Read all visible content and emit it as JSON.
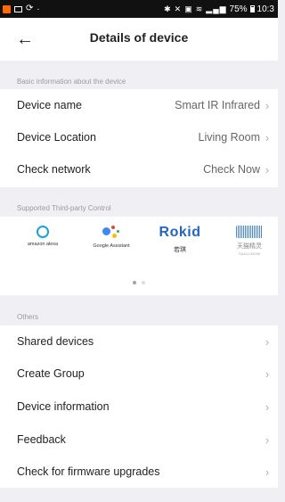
{
  "status_bar": {
    "battery_text": "75%",
    "time": "10:3"
  },
  "header": {
    "title": "Details of device"
  },
  "basic_info": {
    "section_label": "Basic information about the device",
    "rows": [
      {
        "label": "Device name",
        "value": "Smart IR Infrared"
      },
      {
        "label": "Device Location",
        "value": "Living Room"
      },
      {
        "label": "Check network",
        "value": "Check Now"
      }
    ]
  },
  "third_party": {
    "section_label": "Supported Third-party Control",
    "brands": [
      {
        "name": "amazon alexa"
      },
      {
        "name": "Google Assistant"
      },
      {
        "name": "Rokid",
        "caption": "若琪"
      },
      {
        "name": "天猫精灵",
        "caption": "TMALLGENIE"
      }
    ],
    "pager": {
      "page": 1,
      "total": 2
    }
  },
  "others": {
    "section_label": "Others",
    "items": [
      {
        "label": "Shared devices"
      },
      {
        "label": "Create Group"
      },
      {
        "label": "Device information"
      },
      {
        "label": "Feedback"
      },
      {
        "label": "Check for firmware upgrades"
      }
    ]
  },
  "colors": {
    "alexa_blue": "#1aa0e0",
    "rokid_blue": "#2466c0",
    "tmall_blue": "#4a86d9",
    "google": [
      "#4285f4",
      "#ea4335",
      "#fbbc05",
      "#34a853"
    ]
  }
}
